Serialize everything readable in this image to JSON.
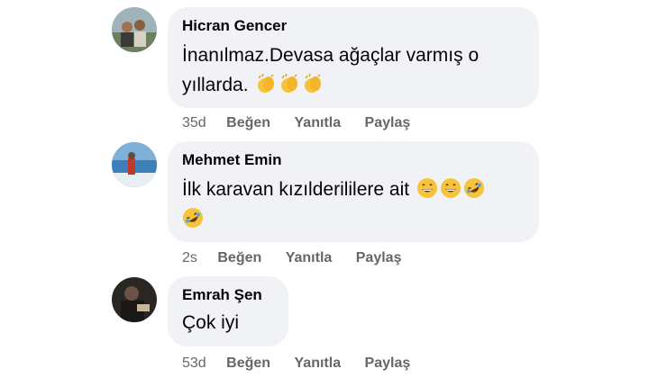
{
  "comments": [
    {
      "author": "Hicran Gencer",
      "line1": "İnanılmaz.Devasa ağaçlar varmış o",
      "line2": "yıllarda.",
      "emojis_line2": [
        "clapping-hands-emoji",
        "clapping-hands-emoji",
        "clapping-hands-emoji"
      ],
      "time": "35d",
      "like": "Beğen",
      "reply": "Yanıtla",
      "share": "Paylaş"
    },
    {
      "author": "Mehmet Emin",
      "line1": "İlk karavan kızılderililere ait",
      "emojis_line1": [
        "grinning-face-emoji",
        "grinning-face-emoji",
        "rolling-laughing-emoji"
      ],
      "emojis_line2": [
        "rolling-laughing-emoji"
      ],
      "time": "2s",
      "like": "Beğen",
      "reply": "Yanıtla",
      "share": "Paylaş"
    },
    {
      "author": "Emrah Şen",
      "line1": "Çok iyi",
      "time": "53d",
      "like": "Beğen",
      "reply": "Yanıtla",
      "share": "Paylaş"
    }
  ],
  "colors": {
    "bubble": "#f0f2f5",
    "meta_text": "#65676b",
    "text": "#050505",
    "emoji_yellow": "#f7c33d"
  }
}
